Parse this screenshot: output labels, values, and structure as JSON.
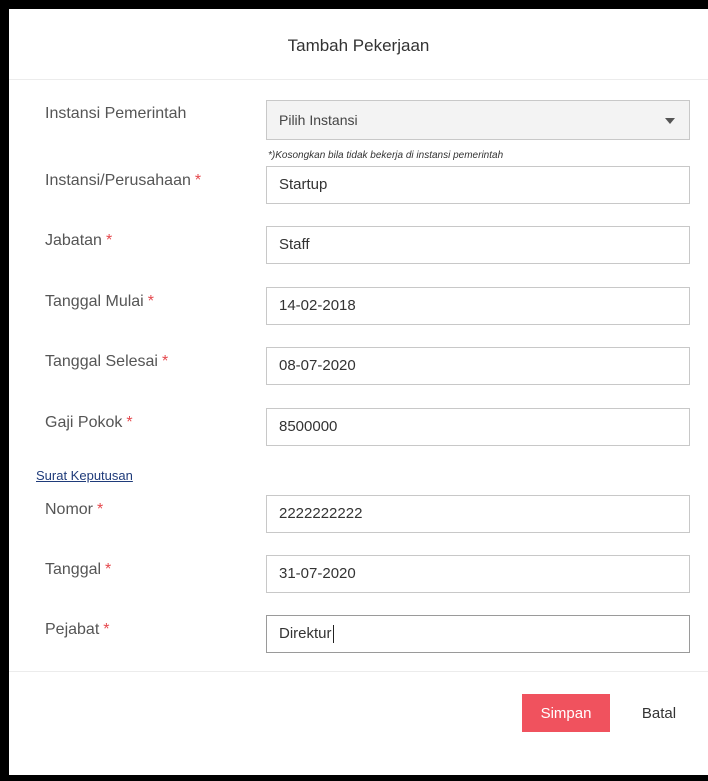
{
  "modal": {
    "title": "Tambah Pekerjaan"
  },
  "fields": {
    "instansi_pemerintah": {
      "label": "Instansi Pemerintah",
      "value": "Pilih Instansi",
      "hint": "*)Kosongkan bila tidak bekerja di instansi pemerintah"
    },
    "instansi_perusahaan": {
      "label": "Instansi/Perusahaan",
      "required": "*",
      "value": "Startup"
    },
    "jabatan": {
      "label": "Jabatan",
      "required": "*",
      "value": "Staff"
    },
    "tanggal_mulai": {
      "label": "Tanggal Mulai",
      "required": "*",
      "value": "14-02-2018"
    },
    "tanggal_selesai": {
      "label": "Tanggal Selesai",
      "required": "*",
      "value": "08-07-2020"
    },
    "gaji_pokok": {
      "label": "Gaji Pokok",
      "required": "*",
      "value": "8500000"
    }
  },
  "surat_keputusan": {
    "section_label": "Surat Keputusan",
    "nomor": {
      "label": "Nomor",
      "required": "*",
      "value": "2222222222"
    },
    "tanggal": {
      "label": "Tanggal",
      "required": "*",
      "value": "31-07-2020"
    },
    "pejabat": {
      "label": "Pejabat",
      "required": "*",
      "value": "Direktur"
    }
  },
  "footer": {
    "save_label": "Simpan",
    "cancel_label": "Batal"
  },
  "colors": {
    "accent": "#f0525e",
    "required": "#e5484d",
    "link": "#1f3b7a"
  },
  "icons": {
    "select_arrow": "chevron-down-icon"
  }
}
